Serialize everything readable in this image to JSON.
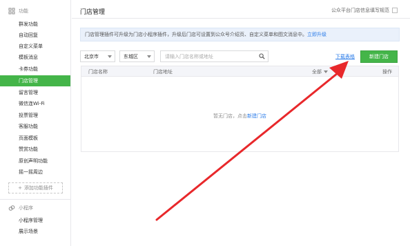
{
  "sidebar": {
    "section_features": "功能",
    "items": [
      {
        "label": "群发功能"
      },
      {
        "label": "自动回复"
      },
      {
        "label": "自定义菜单"
      },
      {
        "label": "模板消息"
      },
      {
        "label": "卡券功能"
      },
      {
        "label": "门店管理",
        "active": true
      },
      {
        "label": "留言管理"
      },
      {
        "label": "微信连Wi-Fi"
      },
      {
        "label": "投票管理"
      },
      {
        "label": "客服功能"
      },
      {
        "label": "页面模板"
      },
      {
        "label": "赞赏功能"
      },
      {
        "label": "原创声明功能"
      },
      {
        "label": "摇一摇周边"
      }
    ],
    "add_plugin": "添加功能插件",
    "section_miniprogram": "小程序",
    "mini_items": [
      {
        "label": "小程序管理"
      },
      {
        "label": "展示场景"
      }
    ]
  },
  "header": {
    "title": "门店管理",
    "checkbox_label": "公众平台门店信息填写规范"
  },
  "notice": {
    "text": "门店管理插件可升级为门店小程序插件，升级后门店可设置到公众号介绍页、自定义菜单和图文消息中。",
    "link": "立即升级"
  },
  "filters": {
    "city": "北京市",
    "district": "东城区",
    "search_placeholder": "请输入门店名称或地址"
  },
  "actions": {
    "download": "下载表格",
    "create": "新建门店"
  },
  "table": {
    "col_name": "门店名称",
    "col_address": "门店地址",
    "col_status": "全部",
    "col_action": "操作",
    "empty_text": "暂无门店，点击",
    "empty_link": "新建门店"
  },
  "colors": {
    "accent": "#44b549",
    "link": "#2b7ce9",
    "annotation_arrow": "#e8282b"
  }
}
